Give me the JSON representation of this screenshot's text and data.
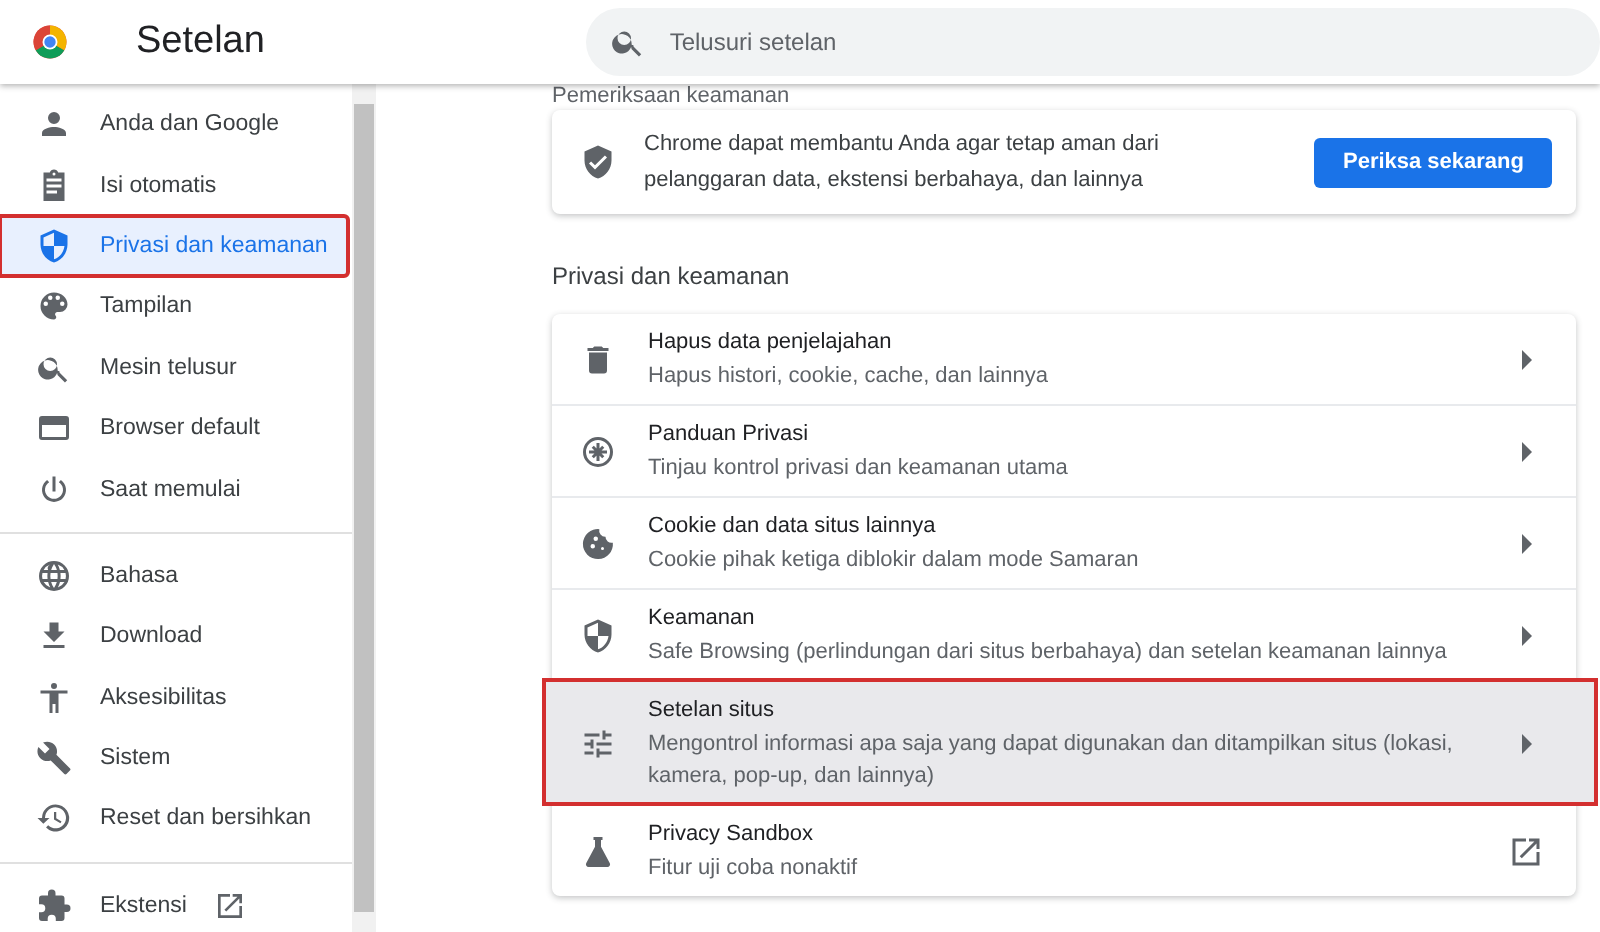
{
  "header": {
    "title": "Setelan",
    "search": {
      "placeholder": "Telusuri setelan"
    }
  },
  "sidebar": {
    "groups": [
      [
        {
          "label": "Anda dan Google",
          "kind": "page",
          "selected": false,
          "annotated": false
        },
        {
          "label": "Isi otomatis",
          "kind": "page",
          "selected": false,
          "annotated": false
        },
        {
          "label": "Privasi dan keamanan",
          "kind": "page",
          "selected": true,
          "annotated": true
        },
        {
          "label": "Tampilan",
          "kind": "page",
          "selected": false,
          "annotated": false
        },
        {
          "label": "Mesin telusur",
          "kind": "page",
          "selected": false,
          "annotated": false
        },
        {
          "label": "Browser default",
          "kind": "page",
          "selected": false,
          "annotated": false
        },
        {
          "label": "Saat memulai",
          "kind": "page",
          "selected": false,
          "annotated": false
        }
      ],
      [
        {
          "label": "Bahasa",
          "kind": "page",
          "selected": false,
          "annotated": false
        },
        {
          "label": "Download",
          "kind": "page",
          "selected": false,
          "annotated": false
        },
        {
          "label": "Aksesibilitas",
          "kind": "page",
          "selected": false,
          "annotated": false
        },
        {
          "label": "Sistem",
          "kind": "page",
          "selected": false,
          "annotated": false
        },
        {
          "label": "Reset dan bersihkan",
          "kind": "page",
          "selected": false,
          "annotated": false
        }
      ],
      [
        {
          "label": "Ekstensi",
          "kind": "external",
          "selected": false,
          "annotated": false
        }
      ]
    ]
  },
  "safety_check": {
    "heading": "Pemeriksaan keamanan",
    "text": "Chrome dapat membantu Anda agar tetap aman dari pelanggaran data, ekstensi berbahaya, dan lainnya",
    "button": "Periksa sekarang"
  },
  "privacy": {
    "heading": "Privasi dan keamanan",
    "rows": [
      {
        "title": "Hapus data penjelajahan",
        "subtitle": "Hapus histori, cookie, cache, dan lainnya",
        "kind": "submenu",
        "hovered": false,
        "annotated": false
      },
      {
        "title": "Panduan Privasi",
        "subtitle": "Tinjau kontrol privasi dan keamanan utama",
        "kind": "submenu",
        "hovered": false,
        "annotated": false
      },
      {
        "title": "Cookie dan data situs lainnya",
        "subtitle": "Cookie pihak ketiga diblokir dalam mode Samaran",
        "kind": "submenu",
        "hovered": false,
        "annotated": false
      },
      {
        "title": "Keamanan",
        "subtitle": "Safe Browsing (perlindungan dari situs berbahaya) dan setelan keamanan lainnya",
        "kind": "submenu",
        "hovered": false,
        "annotated": false
      },
      {
        "title": "Setelan situs",
        "subtitle": "Mengontrol informasi apa saja yang dapat digunakan dan ditampilkan situs (lokasi, kamera, pop-up, dan lainnya)",
        "kind": "submenu",
        "hovered": true,
        "annotated": true
      },
      {
        "title": "Privacy Sandbox",
        "subtitle": "Fitur uji coba nonaktif",
        "kind": "external",
        "hovered": false,
        "annotated": false
      }
    ]
  }
}
